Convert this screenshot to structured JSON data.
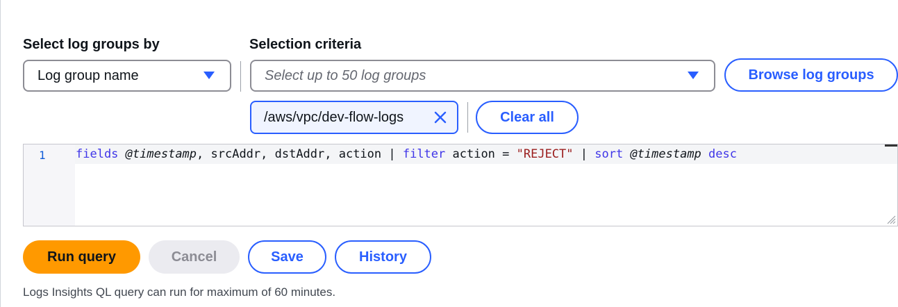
{
  "labels": {
    "select_by": "Select log groups by",
    "criteria": "Selection criteria"
  },
  "select_by": {
    "value": "Log group name"
  },
  "criteria": {
    "placeholder": "Select up to 50 log groups"
  },
  "buttons": {
    "browse": "Browse log groups",
    "clear_all": "Clear all",
    "run": "Run query",
    "cancel": "Cancel",
    "save": "Save",
    "history": "History"
  },
  "selected_token": {
    "label": "/aws/vpc/dev-flow-logs"
  },
  "editor": {
    "line_number": "1",
    "tokens": {
      "t1": "fields",
      "t2": "@timestamp",
      "t3": ", srcAddr, dstAddr, action | ",
      "t4": "filter",
      "t5": " action = ",
      "t6": "\"REJECT\"",
      "t7": " | ",
      "t8": "sort",
      "t9": "@timestamp",
      "t10": "desc"
    }
  },
  "footer_note": "Logs Insights QL query can run for maximum of 60 minutes.",
  "icons": {
    "caret": "caret-down-icon",
    "remove": "close-icon",
    "resize": "resize-handle-icon"
  },
  "colors": {
    "accent": "#295eff",
    "primary": "#ff9900",
    "disabled_bg": "#ebebf0"
  }
}
